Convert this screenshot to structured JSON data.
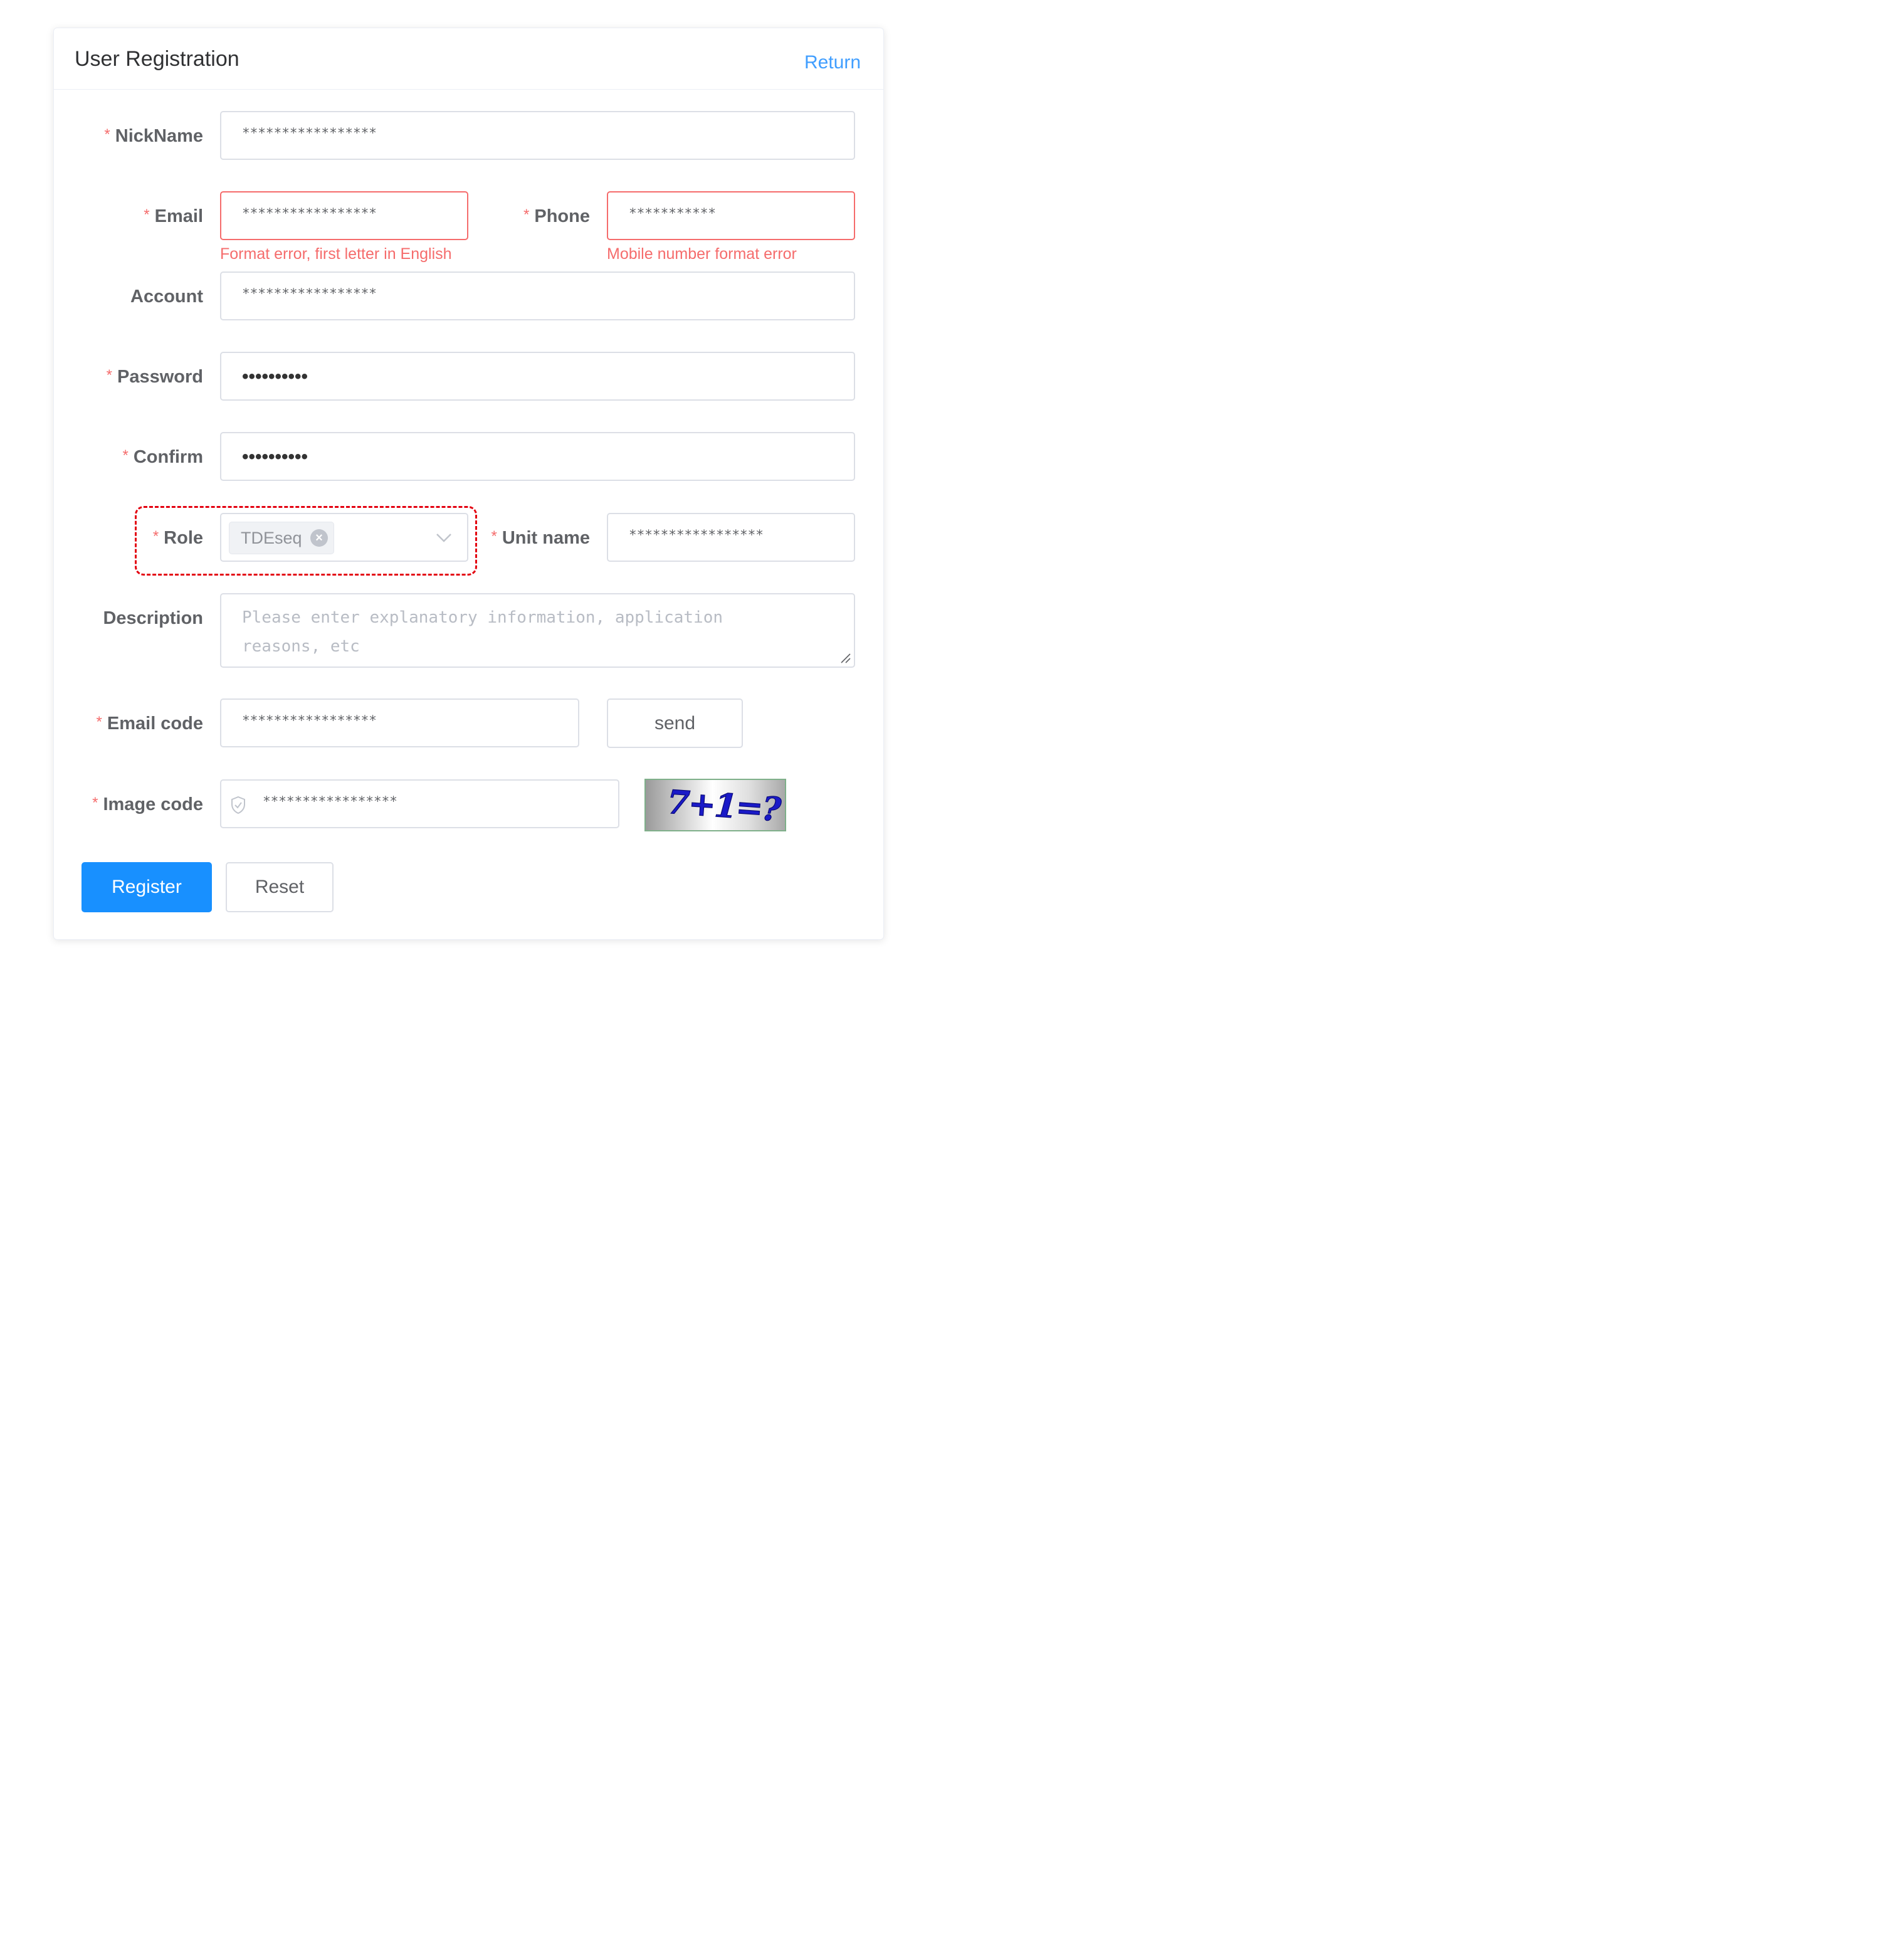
{
  "header": {
    "title": "User Registration",
    "return_label": "Return"
  },
  "form": {
    "nickname": {
      "label": "NickName",
      "value": "*****************"
    },
    "email": {
      "label": "Email",
      "value": "*****************",
      "error": "Format error, first letter in English"
    },
    "phone": {
      "label": "Phone",
      "value": "***********",
      "error": "Mobile number format error"
    },
    "account": {
      "label": "Account",
      "value": "*****************"
    },
    "password": {
      "label": "Password",
      "value": "••••••••••"
    },
    "confirm": {
      "label": "Confirm",
      "value": "••••••••••"
    },
    "role": {
      "label": "Role",
      "tag": "TDEseq"
    },
    "unit_name": {
      "label": "Unit name",
      "value": "*****************"
    },
    "description": {
      "label": "Description",
      "placeholder": "Please enter explanatory information, application reasons, etc"
    },
    "email_code": {
      "label": "Email code",
      "value": "*****************",
      "send_label": "send"
    },
    "image_code": {
      "label": "Image code",
      "value": "*****************",
      "captcha_text": "7+1=?"
    }
  },
  "actions": {
    "register_label": "Register",
    "reset_label": "Reset"
  },
  "required_mark": "*",
  "colors": {
    "primary": "#1890ff",
    "error": "#f56c6c",
    "link": "#409eff",
    "highlight": "#e3000f"
  }
}
